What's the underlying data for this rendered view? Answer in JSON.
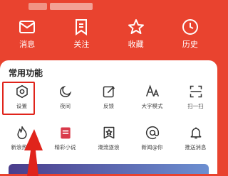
{
  "quick_actions": [
    {
      "icon": "message-icon",
      "label": "消息"
    },
    {
      "icon": "follow-icon",
      "label": "关注"
    },
    {
      "icon": "favorite-icon",
      "label": "收藏"
    },
    {
      "icon": "history-icon",
      "label": "历史"
    }
  ],
  "common_functions": {
    "title": "常用功能",
    "row1": [
      {
        "icon": "settings-icon",
        "label": "设置"
      },
      {
        "icon": "night-mode-icon",
        "label": "夜间"
      },
      {
        "icon": "feedback-icon",
        "label": "反馈"
      },
      {
        "icon": "font-size-icon",
        "label": "大字模式"
      },
      {
        "icon": "scan-icon",
        "label": "扫一扫"
      }
    ],
    "row2": [
      {
        "icon": "hot-news-icon",
        "label": "新浪热榜"
      },
      {
        "icon": "novel-icon",
        "label": "精彩小说"
      },
      {
        "icon": "trend-icon",
        "label": "潮流逐浪"
      },
      {
        "icon": "mention-icon",
        "label": "新闻@你"
      },
      {
        "icon": "bell-icon",
        "label": "推送消息"
      }
    ]
  },
  "colors": {
    "brand_red": "#e9432f",
    "highlight_red": "#e0241b"
  }
}
